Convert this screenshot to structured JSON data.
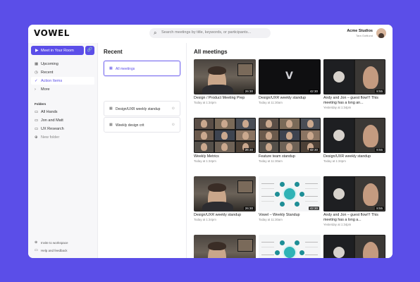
{
  "app": {
    "logo": "VOWEL",
    "search_placeholder": "Search meetings by title, keywords, or participants...",
    "org_name": "Acme Studios",
    "org_user": "Tara Gottlund"
  },
  "sidebar": {
    "meet_button": "Meet in Your Room",
    "nav": [
      {
        "label": "Upcoming",
        "icon": "calendar-icon"
      },
      {
        "label": "Recent",
        "icon": "clock-icon"
      },
      {
        "label": "Action Items",
        "icon": "check-icon"
      },
      {
        "label": "More",
        "icon": "chevron-right-icon"
      }
    ],
    "folders_title": "Folders",
    "folders": [
      "All Hands",
      "Jon and Matt",
      "UX Research"
    ],
    "new_folder": "New folder",
    "bottom": [
      "Invite to workspace",
      "Help and feedback"
    ]
  },
  "recent": {
    "title": "Recent",
    "items": [
      "All meetings",
      "Design/UXR weekly standup",
      "Weekly design crit"
    ]
  },
  "main": {
    "title": "All meetings",
    "meetings": [
      {
        "title": "Design / Product Meeting Prep",
        "time": "Today at 1:34pm",
        "duration": "26:30",
        "thumb": "person"
      },
      {
        "title": "Design/UXR weekly standup",
        "time": "Today at 11:30am",
        "duration": "42:30",
        "thumb": "logo"
      },
      {
        "title": "Andy and Jon – guest flow!!! This meeting has a long an...",
        "time": "Yesterday at 1:34pm",
        "duration": "8:55",
        "thumb": "duo"
      },
      {
        "title": "Weekly Metrics",
        "time": "Today at 1:34pm",
        "duration": "26:30",
        "thumb": "grid"
      },
      {
        "title": "Feature team standup",
        "time": "Today at 11:30am",
        "duration": "42:30",
        "thumb": "grid"
      },
      {
        "title": "Design/UXR weekly standup",
        "time": "Today at 1:34pm",
        "duration": "8:55",
        "thumb": "duo"
      },
      {
        "title": "Design/UXR weekly standup",
        "time": "Today at 1:34pm",
        "duration": "26:30",
        "thumb": "person"
      },
      {
        "title": "Vowel – Weekly Standup",
        "time": "Today at 11:30am",
        "duration": "42:30",
        "thumb": "diagram"
      },
      {
        "title": "Andy and Jon – guest flow!!! This meeting has a long a...",
        "time": "Yesterday at 1:34pm",
        "duration": "8:55",
        "thumb": "duo"
      },
      {
        "title": "",
        "time": "",
        "duration": "",
        "thumb": "person"
      },
      {
        "title": "",
        "time": "",
        "duration": "",
        "thumb": "diagram"
      },
      {
        "title": "",
        "time": "",
        "duration": "",
        "thumb": "duo"
      }
    ]
  },
  "colors": {
    "accent": "#5b4ee8",
    "background": "#5b4ee8"
  }
}
